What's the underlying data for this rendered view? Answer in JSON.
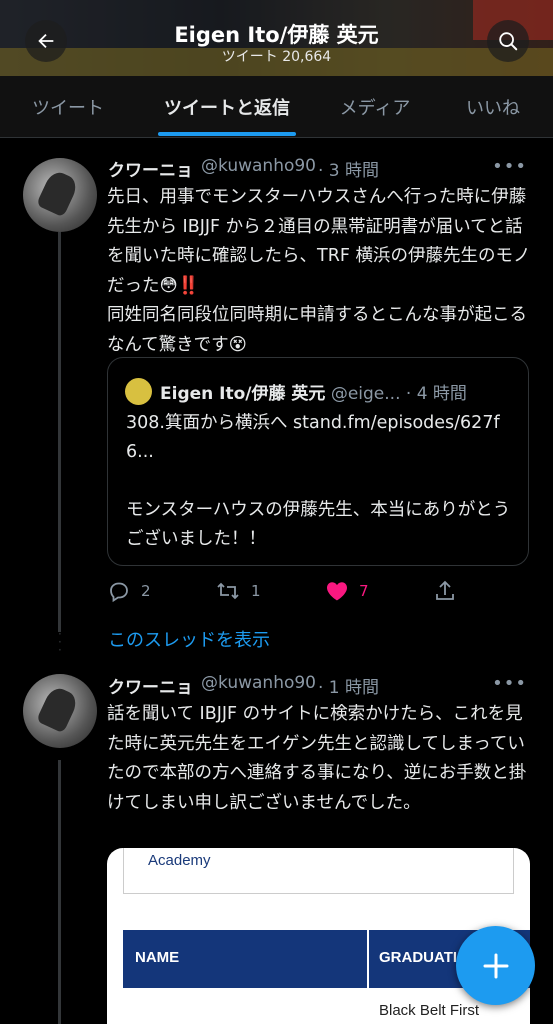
{
  "header": {
    "title": "Eigen Ito/伊藤 英元",
    "subtitle": "ツイート 20,664"
  },
  "tabs": [
    {
      "label": "ツイート",
      "active": false
    },
    {
      "label": "ツイートと返信",
      "active": true
    },
    {
      "label": "メディア",
      "active": false
    },
    {
      "label": "いいね",
      "active": false
    }
  ],
  "tweets": [
    {
      "name": "クワーニョ",
      "handle": "@kuwanho90",
      "time": "· 3 時間",
      "text": "先日、用事でモンスターハウスさんへ行った時に伊藤先生から IBJJF から２通目の黒帯証明書が届いてと話を聞いた時に確認したら、TRF 横浜の伊藤先生のモノだった😳‼️\n同姓同名同段位同時期に申請するとこんな事が起こるなんて驚きです😵",
      "quote": {
        "name": "Eigen Ito/伊藤 英元",
        "handle": "@eige...",
        "time": "· 4 時間",
        "text": "308.箕面から横浜へ stand.fm/episodes/627f6...\n\nモンスターハウスの伊藤先生、本当にありがとうございました！！"
      },
      "replies": "2",
      "retweets": "1",
      "likes": "7"
    },
    {
      "name": "クワーニョ",
      "handle": "@kuwanho90",
      "time": "· 1 時間",
      "text": "話を聞いて IBJJF のサイトに検索かけたら、これを見た時に英元先生をエイゲン先生と認識してしまっていたので本部の方へ連絡する事になり、逆にお手数と掛けてしまい申し訳ございませんでした。"
    }
  ],
  "show_thread": "このスレッドを表示",
  "image": {
    "academy": "Academy",
    "col_name": "NAME",
    "col_graduation": "GRADUATIO",
    "cell": "Black Belt First"
  },
  "colors": {
    "accent": "#1d9bf0",
    "like": "#f91880",
    "background": "#000000"
  },
  "icons": [
    "back-arrow-icon",
    "search-icon",
    "more-icon",
    "reply-icon",
    "retweet-icon",
    "heart-icon",
    "share-icon",
    "compose-plus-icon"
  ]
}
